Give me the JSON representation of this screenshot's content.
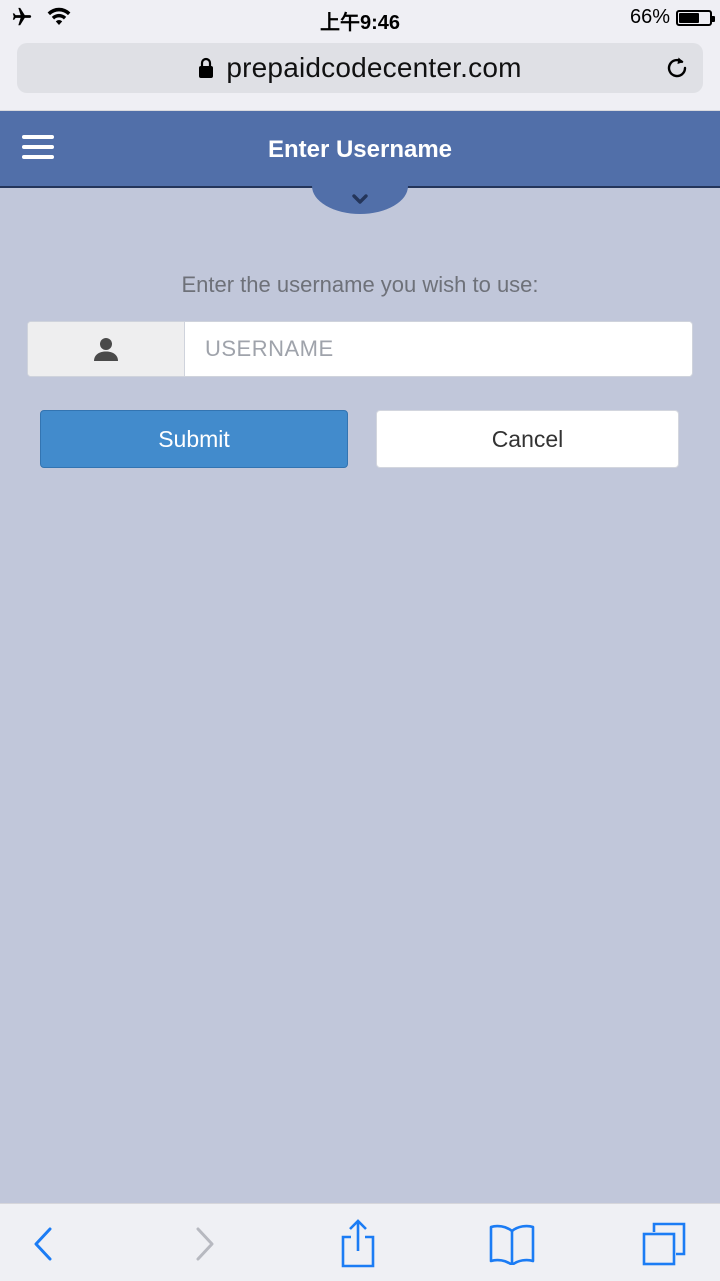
{
  "status_bar": {
    "time": "上午9:46",
    "battery_percent": "66%",
    "battery_level": 0.66
  },
  "browser": {
    "url": "prepaidcodecenter.com"
  },
  "header": {
    "title": "Enter Username"
  },
  "form": {
    "prompt": "Enter the username you wish to use:",
    "username_placeholder": "USERNAME",
    "username_value": "",
    "submit_label": "Submit",
    "cancel_label": "Cancel"
  },
  "colors": {
    "header_bg": "#516fa9",
    "page_bg": "#c1c7da",
    "submit_bg": "#428bcc",
    "ios_blue": "#1b7cf4"
  }
}
